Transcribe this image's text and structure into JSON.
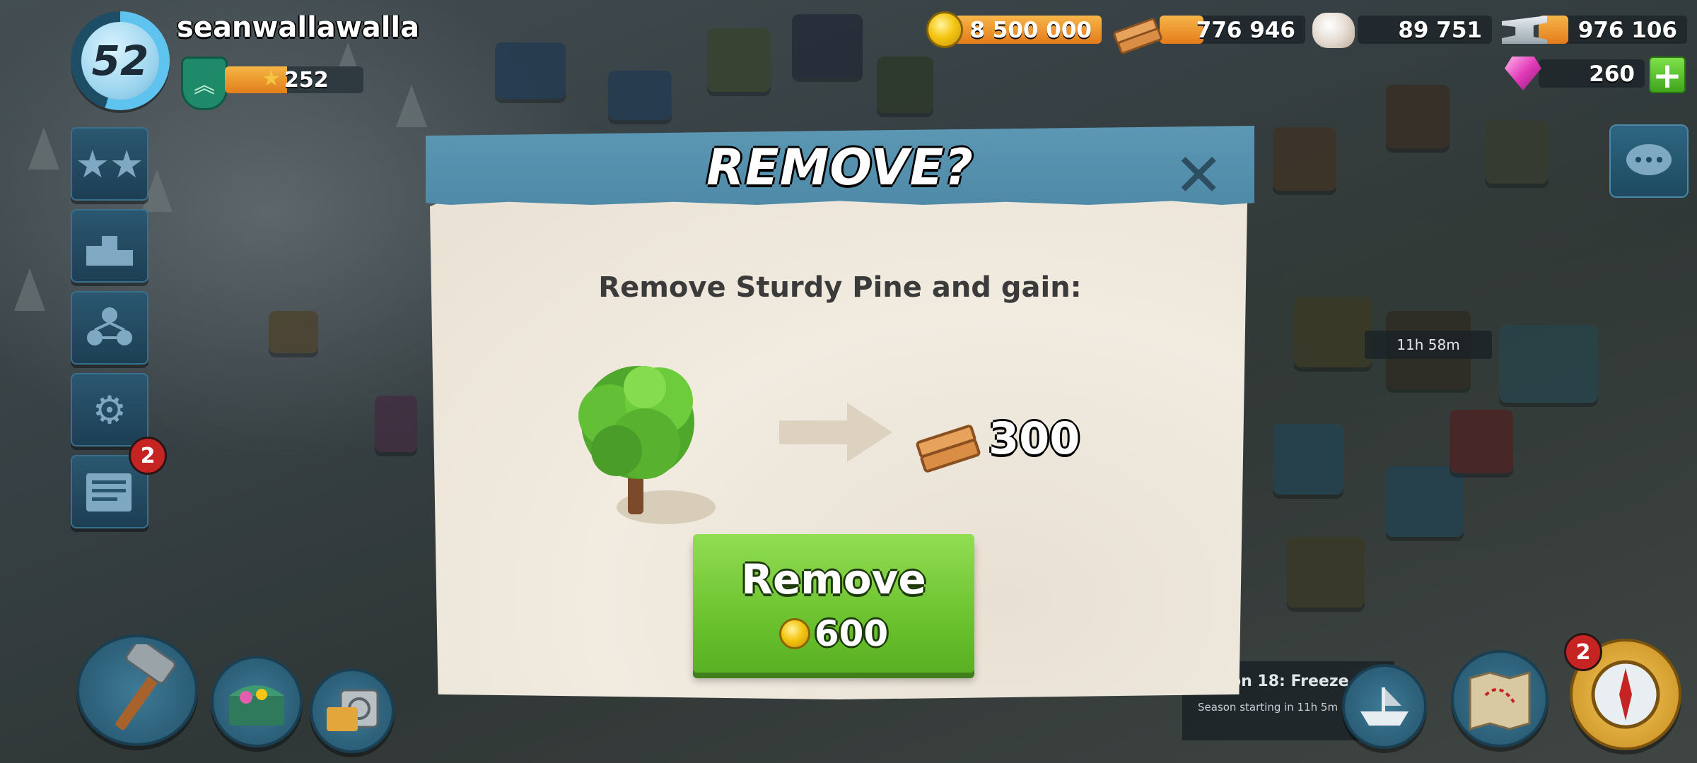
{
  "player": {
    "level": "52",
    "username": "seanwallawalla",
    "victory_points": "252",
    "vp_fraction": 0.45
  },
  "resources": {
    "gold": "8 500 000",
    "wood": "776 946",
    "stone": "89 751",
    "iron": "976 106",
    "diamonds": "260",
    "gold_fraction": 1.0,
    "wood_fraction": 0.3,
    "iron_fraction": 0.2
  },
  "side_menu": [
    {
      "name": "achievements",
      "icon": "stars-icon"
    },
    {
      "name": "leaderboard",
      "icon": "podium-icon"
    },
    {
      "name": "task-force",
      "icon": "team-icon"
    },
    {
      "name": "settings",
      "icon": "gear-icon"
    },
    {
      "name": "news",
      "icon": "newspaper-icon",
      "badge": "2"
    }
  ],
  "map": {
    "timer": "11h 58m"
  },
  "season": {
    "title": "on 18: Freeze",
    "subtitle": "Season starting in 11h 5m"
  },
  "bottom": {
    "radar_badge": "2"
  },
  "dialog": {
    "title": "REMOVE?",
    "prompt": "Remove Sturdy Pine and gain:",
    "reward_amount": "300",
    "reward_icon": "wood-icon",
    "button_label": "Remove",
    "button_cost": "600",
    "cost_icon": "gold-coin-icon"
  },
  "colors": {
    "header_blue": "#5c97b4",
    "button_green": "#6cc32f",
    "gold": "#f5c612",
    "parchment": "#f1ebe0"
  }
}
